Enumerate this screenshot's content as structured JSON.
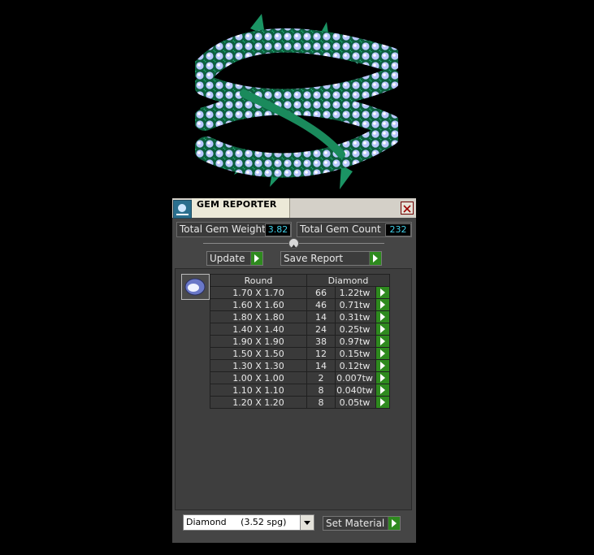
{
  "panel": {
    "title": "GEM REPORTER",
    "close_icon": "close-icon",
    "logo_icon": "gem-reporter-logo-icon"
  },
  "stats": {
    "weight_label": "Total Gem Weight",
    "weight_value": "3.82",
    "count_label": "Total Gem Count",
    "count_value": "232"
  },
  "buttons": {
    "update": "Update",
    "save_report": "Save Report",
    "set_material": "Set Material"
  },
  "table": {
    "col_shape": "Round",
    "col_material": "Diamond",
    "rows": [
      {
        "size": "1.70 X 1.70",
        "count": "66",
        "weight": "1.22tw"
      },
      {
        "size": "1.60 X 1.60",
        "count": "46",
        "weight": "0.71tw"
      },
      {
        "size": "1.80 X 1.80",
        "count": "14",
        "weight": "0.31tw"
      },
      {
        "size": "1.40 X 1.40",
        "count": "24",
        "weight": "0.25tw"
      },
      {
        "size": "1.90 X 1.90",
        "count": "38",
        "weight": "0.97tw"
      },
      {
        "size": "1.50 X 1.50",
        "count": "12",
        "weight": "0.15tw"
      },
      {
        "size": "1.30 X 1.30",
        "count": "14",
        "weight": "0.12tw"
      },
      {
        "size": "1.00 X 1.00",
        "count": "2",
        "weight": "0.007tw"
      },
      {
        "size": "1.10 X 1.10",
        "count": "8",
        "weight": "0.040tw"
      },
      {
        "size": "1.20 X 1.20",
        "count": "8",
        "weight": "0.05tw"
      }
    ]
  },
  "material_select": {
    "value": "Diamond     (3.52 spg)"
  },
  "colors": {
    "accent_green": "#2e8a1e",
    "value_cyan": "#42d0e8",
    "gem_green": "#1c9a6a",
    "gem_white": "#c8d8ff"
  }
}
